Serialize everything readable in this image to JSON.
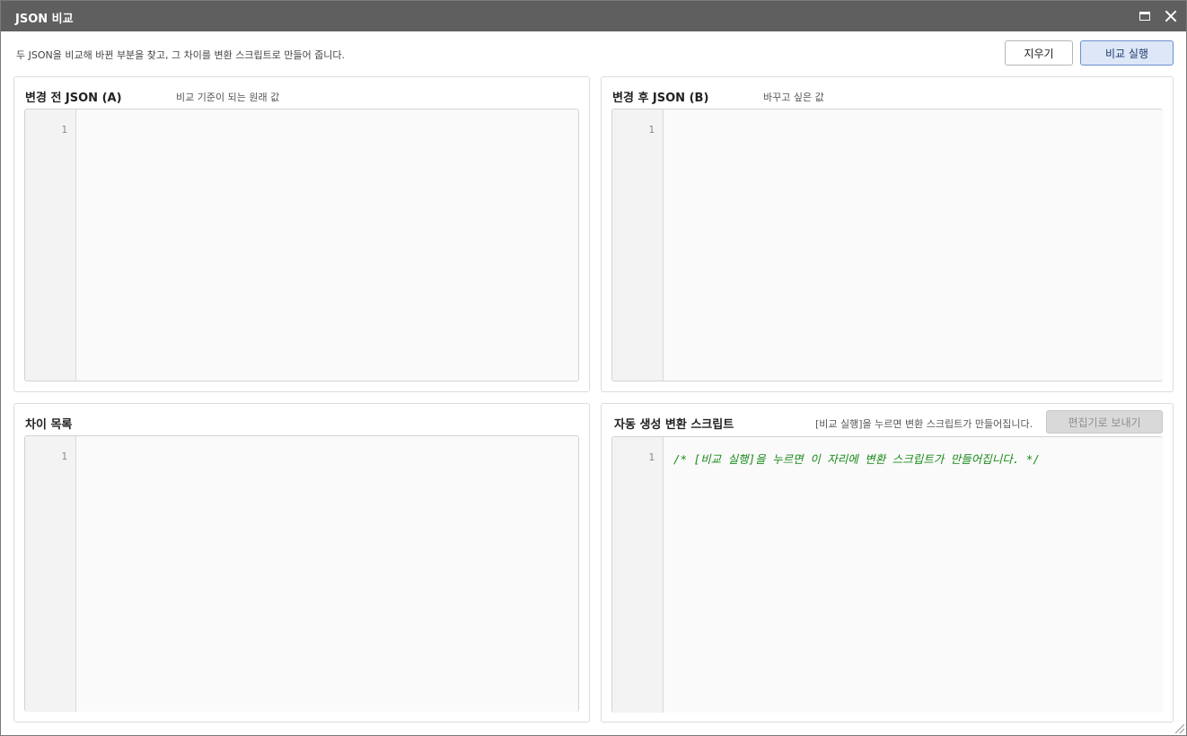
{
  "window": {
    "title": "JSON 비교",
    "maximize_icon": "maximize-icon",
    "close_icon": "close-icon"
  },
  "toolbar": {
    "description": "두 JSON을 비교해 바뀐 부분을 찾고, 그 차이를 변환 스크립트로 만들어 줍니다.",
    "clear_label": "지우기",
    "run_label": "비교 실행"
  },
  "panels": {
    "before": {
      "title": "변경 전 JSON (A)",
      "subtitle": "비교 기준이 되는 원래 값",
      "line_numbers": [
        "1"
      ],
      "content": ""
    },
    "after": {
      "title": "변경 후 JSON (B)",
      "subtitle": "바꾸고 싶은 값",
      "line_numbers": [
        "1"
      ],
      "content": ""
    },
    "diff": {
      "title": "차이 목록",
      "line_numbers": [
        "1"
      ],
      "content": ""
    },
    "script": {
      "title": "자동 생성 변환 스크립트",
      "subtitle": "[비교 실행]을 누르면 변환 스크립트가 만들어집니다.",
      "send_label": "편집기로 보내기",
      "line_numbers": [
        "1"
      ],
      "content": "/* [비교 실행]을 누르면 이 자리에 변환 스크립트가 만들어집니다. */"
    }
  },
  "colors": {
    "titlebar": "#5f5f5f",
    "primary_button_bg": "#dde7f7",
    "primary_button_border": "#6c8fcf",
    "comment_text": "#1a8a1a",
    "disabled_button_bg": "#d9d9d9"
  }
}
